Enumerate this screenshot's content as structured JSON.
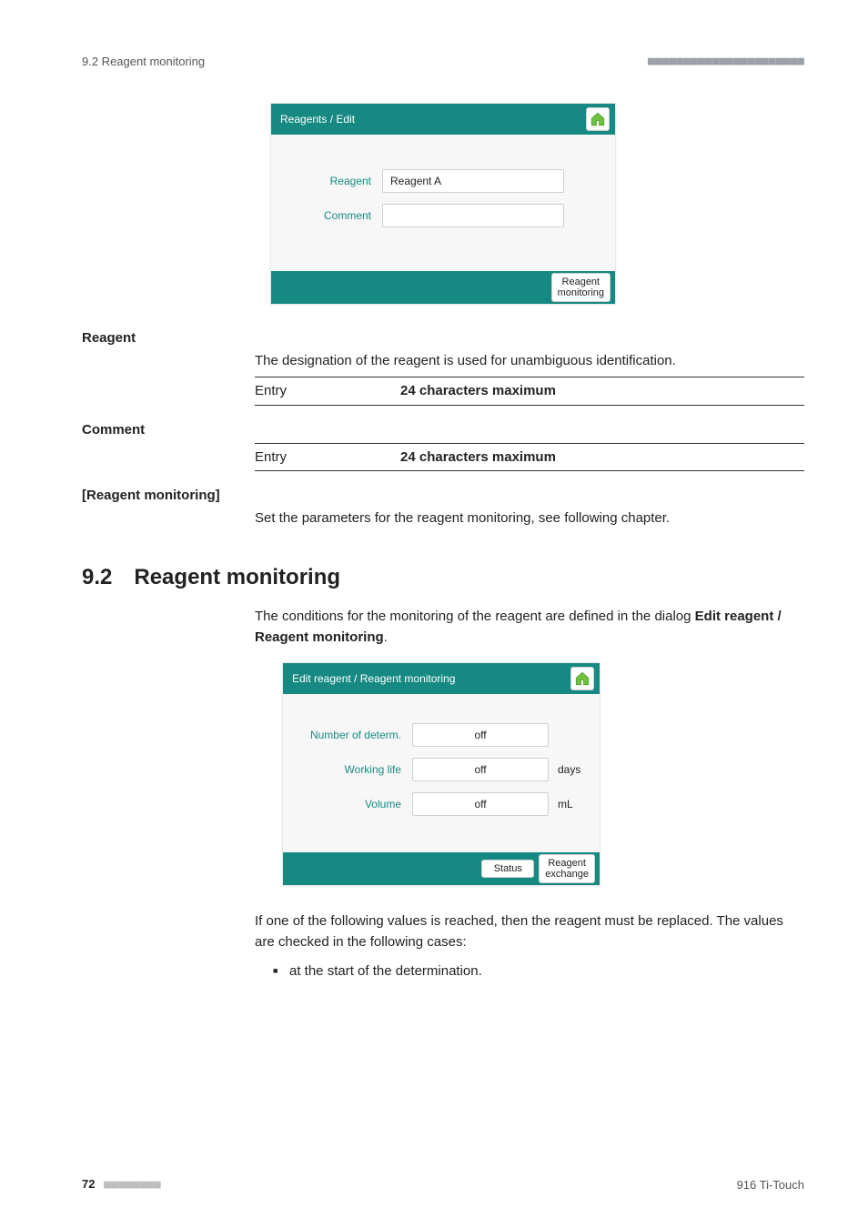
{
  "running_header": {
    "left": "9.2 Reagent monitoring",
    "right": "■■■■■■■■■■■■■■■■■■■■■■"
  },
  "panel1": {
    "title": "Reagents / Edit",
    "rows": {
      "reagent": {
        "label": "Reagent",
        "value": "Reagent A"
      },
      "comment": {
        "label": "Comment",
        "value": ""
      }
    },
    "footer_button": "Reagent\nmonitoring"
  },
  "defs": {
    "reagent_label": "Reagent",
    "reagent_desc": "The designation of the reagent is used for unambiguous identification.",
    "reagent_entry_key": "Entry",
    "reagent_entry_val": "24 characters maximum",
    "comment_label": "Comment",
    "comment_entry_key": "Entry",
    "comment_entry_val": "24 characters maximum",
    "rm_label": "[Reagent monitoring]",
    "rm_desc": "Set the parameters for the reagent monitoring, see following chapter."
  },
  "section": {
    "number": "9.2",
    "title": "Reagent monitoring",
    "intro_a": "The conditions for the monitoring of the reagent are defined in the dialog ",
    "intro_b": "Edit reagent / Reagent monitoring",
    "intro_c": "."
  },
  "panel2": {
    "title": "Edit reagent / Reagent monitoring",
    "rows": {
      "nod": {
        "label": "Number of determ.",
        "value": "off",
        "unit": ""
      },
      "wl": {
        "label": "Working life",
        "value": "off",
        "unit": "days"
      },
      "vol": {
        "label": "Volume",
        "value": "off",
        "unit": "mL"
      }
    },
    "footer_status": "Status",
    "footer_exchange": "Reagent\nexchange"
  },
  "after_panel": {
    "p": "If one of the following values is reached, then the reagent must be replaced. The values are checked in the following cases:",
    "li1": "at the start of the determination."
  },
  "footer": {
    "page_no": "72",
    "bars": "■■■■■■■■",
    "product": "916 Ti-Touch"
  }
}
